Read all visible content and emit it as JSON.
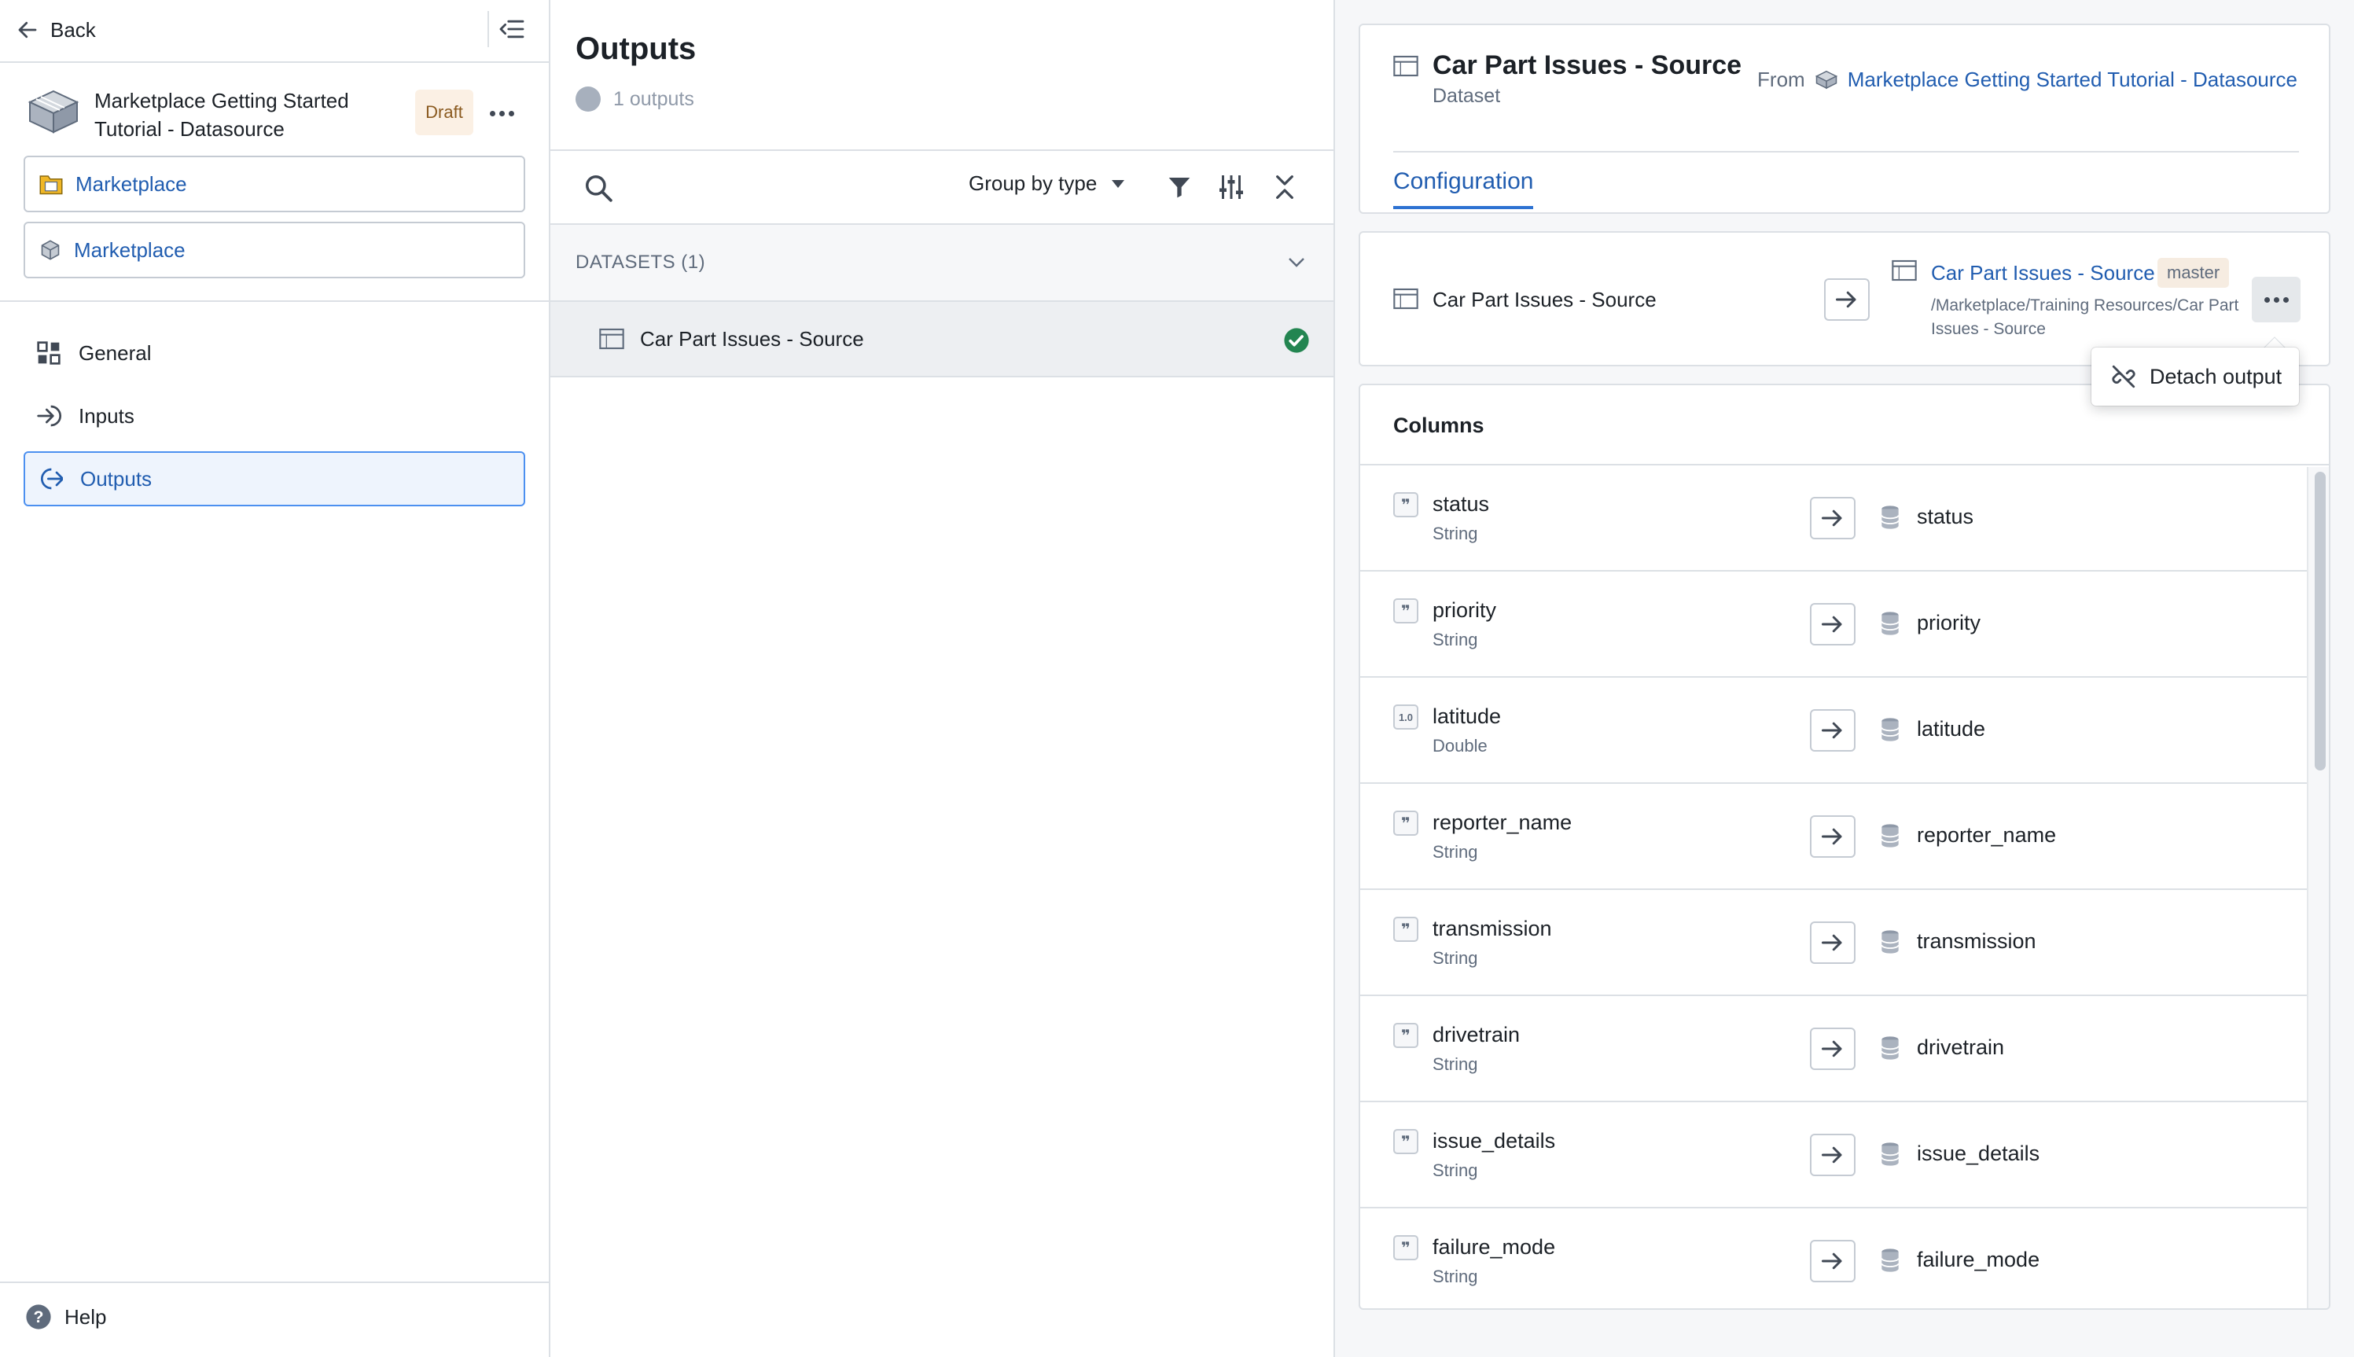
{
  "sidebar": {
    "back_label": "Back",
    "project_title": "Marketplace Getting Started Tutorial - Datasource",
    "draft_label": "Draft",
    "links": [
      {
        "label": "Marketplace",
        "icon": "folder-icon"
      },
      {
        "label": "Marketplace",
        "icon": "cube-icon"
      }
    ],
    "nav": [
      {
        "label": "General",
        "icon": "grid-icon"
      },
      {
        "label": "Inputs",
        "icon": "log-in-icon"
      },
      {
        "label": "Outputs",
        "icon": "log-out-icon"
      }
    ],
    "help_label": "Help"
  },
  "middle": {
    "title": "Outputs",
    "subtitle": "1 outputs",
    "group_by_label": "Group by type",
    "section_label": "DATASETS (1)",
    "dataset_name": "Car Part Issues - Source"
  },
  "right": {
    "header": {
      "title": "Car Part Issues - Source",
      "subtitle": "Dataset",
      "from_label": "From",
      "from_link": "Marketplace Getting Started Tutorial - Datasource",
      "tab": "Configuration"
    },
    "mapping": {
      "source_name": "Car Part Issues - Source",
      "target_name": "Car Part Issues - Source",
      "branch": "master",
      "path": "/Marketplace/Training Resources/Car Part Issues - Source"
    },
    "menu_item": "Detach output",
    "columns_title": "Columns",
    "columns": [
      {
        "name": "status",
        "type": "String",
        "target": "status",
        "icon": "string-icon"
      },
      {
        "name": "priority",
        "type": "String",
        "target": "priority",
        "icon": "string-icon"
      },
      {
        "name": "latitude",
        "type": "Double",
        "target": "latitude",
        "icon": "double-icon"
      },
      {
        "name": "reporter_name",
        "type": "String",
        "target": "reporter_name",
        "icon": "string-icon"
      },
      {
        "name": "transmission",
        "type": "String",
        "target": "transmission",
        "icon": "string-icon"
      },
      {
        "name": "drivetrain",
        "type": "String",
        "target": "drivetrain",
        "icon": "string-icon"
      },
      {
        "name": "issue_details",
        "type": "String",
        "target": "issue_details",
        "icon": "string-icon"
      },
      {
        "name": "failure_mode",
        "type": "String",
        "target": "failure_mode",
        "icon": "string-icon"
      }
    ]
  },
  "colors": {
    "accent": "#2d72d2",
    "link": "#215db0",
    "success": "#238551",
    "draft_bg": "#fbf0e4"
  }
}
